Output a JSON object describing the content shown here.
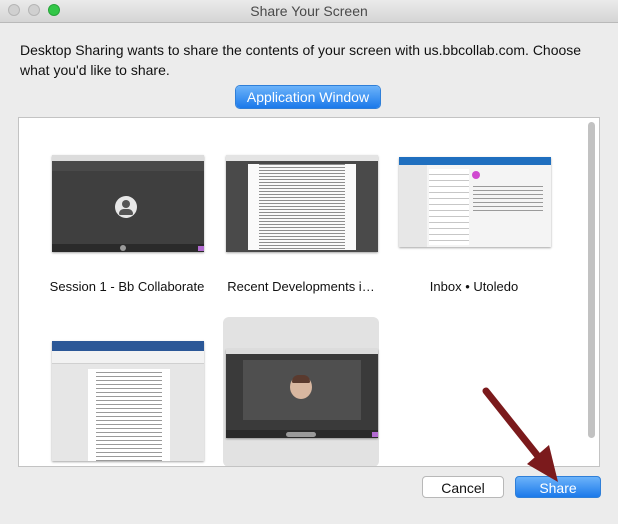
{
  "window": {
    "title": "Share Your Screen"
  },
  "prompt": {
    "text": "Desktop Sharing wants to share the contents of your screen with us.bbcollab.com. Choose what you'd like to share."
  },
  "mode_button": {
    "label": "Application Window"
  },
  "windows": [
    {
      "label": "Session 1 - Bb Collaborate",
      "selected": false
    },
    {
      "label": "Recent Developments i…",
      "selected": false
    },
    {
      "label": "Inbox • Utoledo",
      "selected": false
    },
    {
      "label": "",
      "selected": false
    },
    {
      "label": "",
      "selected": true
    }
  ],
  "actions": {
    "cancel_label": "Cancel",
    "share_label": "Share"
  },
  "colors": {
    "accent": "#1b79ea",
    "annotation_arrow": "#7b1a1c"
  }
}
